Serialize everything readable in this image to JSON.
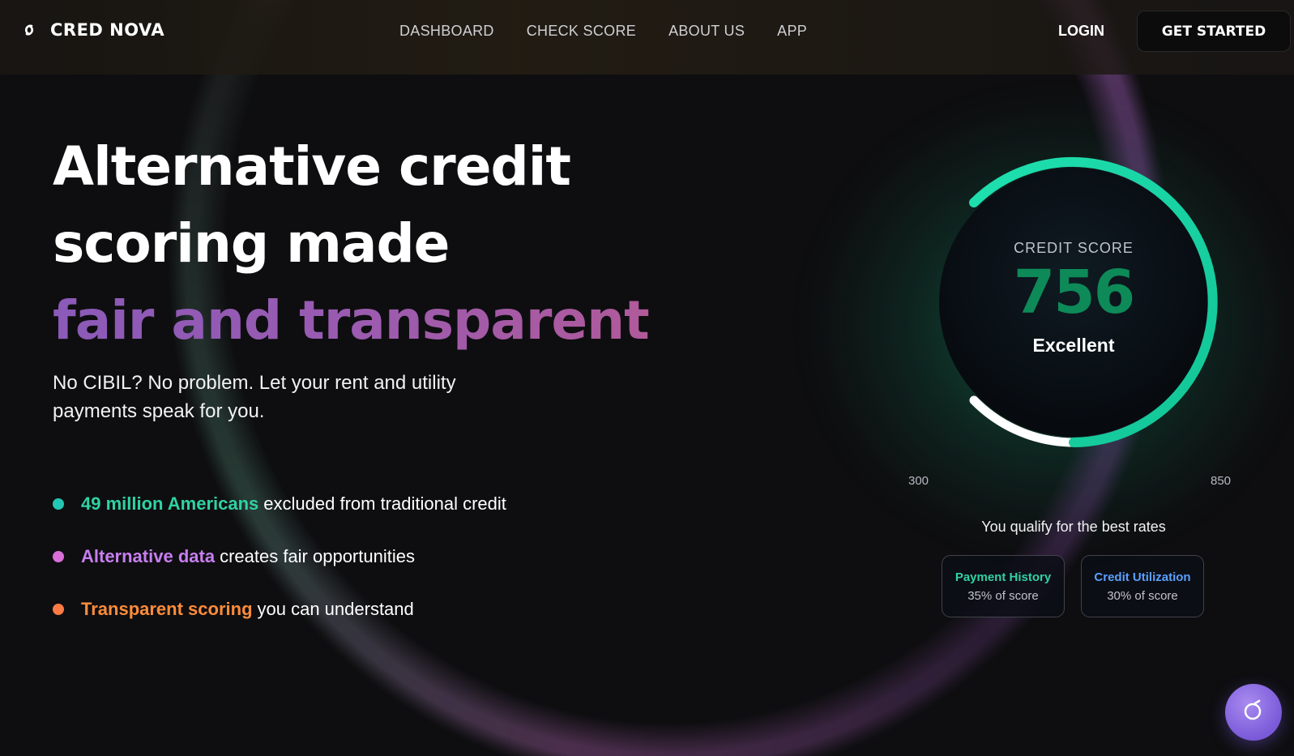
{
  "brand": {
    "name": "CRED NOVA",
    "icon": "logo-mark-icon"
  },
  "nav": {
    "items": [
      "DASHBOARD",
      "CHECK SCORE",
      "ABOUT US",
      "APP"
    ]
  },
  "header": {
    "login_label": "LOGIN",
    "cta_label": "GET STARTED"
  },
  "hero": {
    "headline_line1": "Alternative credit",
    "headline_line2": "scoring made",
    "headline_line3": "fair and transparent",
    "subtitle": "No CIBIL? No problem. Let your rent and utility payments speak for you.",
    "bullets": [
      {
        "highlight": "49 million Americans",
        "text": "excluded from traditional credit",
        "color": "#2fd2a3",
        "dot": "#23c7b4"
      },
      {
        "highlight": "Alternative data",
        "text": "creates fair opportunities",
        "color": "#c77ef0",
        "dot": "#d86fd8"
      },
      {
        "highlight": "Transparent scoring",
        "text": "you can understand",
        "color": "#ff8c3a",
        "dot": "#ff7a45"
      }
    ]
  },
  "score": {
    "label": "CREDIT SCORE",
    "value": "756",
    "rating": "Excellent",
    "min": "300",
    "max": "850",
    "qualify_text": "You qualify for the best rates",
    "factors": [
      {
        "name": "Payment History",
        "weight": "35% of score",
        "color": "#2fd2a3"
      },
      {
        "name": "Credit Utilization",
        "weight": "30% of score",
        "color": "#5aa0ff"
      }
    ]
  },
  "colors": {
    "accent_green": "#1ed8a8",
    "score_value": "#0d8a58",
    "fab": "#8a6ae0"
  },
  "fab": {
    "icon": "chat-bubble-icon"
  }
}
